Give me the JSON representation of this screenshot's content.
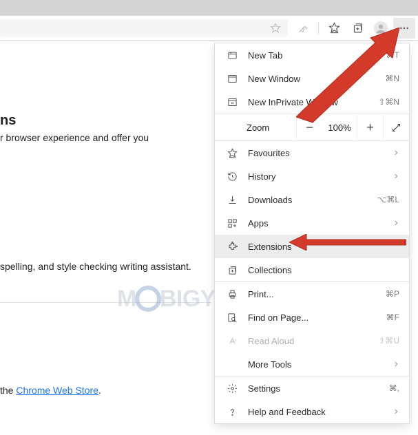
{
  "toolbar": {
    "star_action": "star-icon",
    "reader_action": "reader-icon",
    "fav_action": "favourites-icon",
    "collections_action": "collections-icon",
    "profile_action": "profile-icon",
    "menu_action": "more-icon"
  },
  "page": {
    "heading_fragment": "ns",
    "desc_fragment": "r browser experience and offer you",
    "assistant_fragment": "spelling, and style checking writing assistant.",
    "webstore_fragment_pre": "the ",
    "webstore_link": "Chrome Web Store",
    "webstore_fragment_post": "."
  },
  "menu": {
    "new_tab": {
      "label": "New Tab",
      "kbd": "⌘T"
    },
    "new_window": {
      "label": "New Window",
      "kbd": "⌘N"
    },
    "new_inprivate": {
      "label": "New InPrivate Window",
      "kbd": "⇧⌘N"
    },
    "zoom": {
      "label": "Zoom",
      "value": "100%"
    },
    "favourites": {
      "label": "Favourites"
    },
    "history": {
      "label": "History"
    },
    "downloads": {
      "label": "Downloads",
      "kbd": "⌥⌘L"
    },
    "apps": {
      "label": "Apps"
    },
    "extensions": {
      "label": "Extensions"
    },
    "collections": {
      "label": "Collections"
    },
    "print": {
      "label": "Print...",
      "kbd": "⌘P"
    },
    "find": {
      "label": "Find on Page...",
      "kbd": "⌘F"
    },
    "read_aloud": {
      "label": "Read Aloud",
      "kbd": "⇧⌘U"
    },
    "more_tools": {
      "label": "More Tools"
    },
    "settings": {
      "label": "Settings",
      "kbd": "⌘,"
    },
    "help": {
      "label": "Help and Feedback"
    }
  },
  "watermark": {
    "pre": "M",
    "post": "BIGYAAN"
  }
}
